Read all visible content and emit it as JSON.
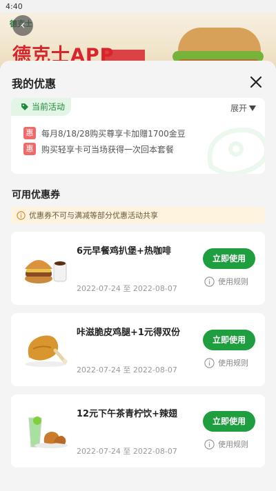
{
  "status_bar": {
    "time": "4:40"
  },
  "banner": {
    "logo_text": "德克士",
    "headline": "德克士APP"
  },
  "sheet": {
    "title": "我的优惠"
  },
  "activity": {
    "tag_label": "当前活动",
    "expand_label": "展开",
    "badge_text": "惠",
    "items": [
      "每月8/18/28购买尊享卡加赠1700金豆",
      "购买轻享卡可当场获得一次回本套餐"
    ]
  },
  "coupons_section": {
    "title": "可用优惠券",
    "notice": "优惠券不可与满减等部分优惠活动共享"
  },
  "coupons": [
    {
      "title": "6元早餐鸡扒堡+热咖啡",
      "date": "2022-07-24 至 2022-08-07",
      "button": "立即使用",
      "rules": "使用规则"
    },
    {
      "title": "咔滋脆皮鸡腿+1元得双份",
      "date": "2022-07-24 至 2022-08-07",
      "button": "立即使用",
      "rules": "使用规则"
    },
    {
      "title": "12元下午茶青柠饮+辣翅",
      "date": "2022-07-24 至 2022-08-07",
      "button": "立即使用",
      "rules": "使用规则"
    }
  ],
  "colors": {
    "accent_green": "#1e9e3e",
    "badge_red": "#ef6b6b",
    "notice_bg": "#fdf3df"
  }
}
